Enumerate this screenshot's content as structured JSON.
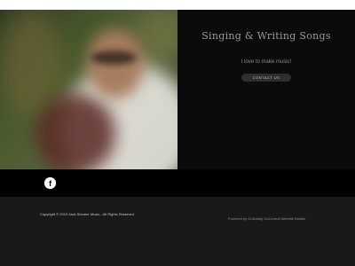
{
  "hero": {
    "title": "Singing & Writing Songs",
    "tagline": "I love to make music!",
    "cta_label": "CONTACT US"
  },
  "social": {
    "facebook_icon": "facebook-icon",
    "facebook_letter": "f"
  },
  "footer": {
    "copyright": "Copyright © 2019 Jack Shearer Music - All Rights Reserved.",
    "powered_by": "Powered by GoDaddy GoCentral Website Builder"
  },
  "colors": {
    "background": "#191919",
    "hero_bg": "#0b0b0b",
    "button_bg": "#2e2e2e"
  }
}
